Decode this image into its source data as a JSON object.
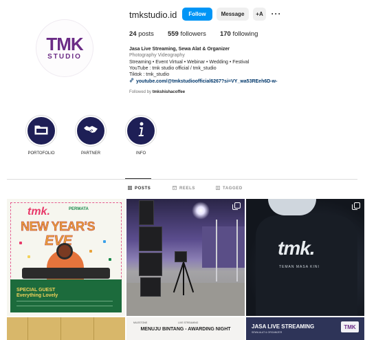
{
  "profile": {
    "username": "tmkstudio.id",
    "avatar_text": "TMK",
    "avatar_subtext": "STUDIO",
    "follow_label": "Follow",
    "message_label": "Message",
    "suggest_icon": "+A",
    "more_icon": "···"
  },
  "stats": {
    "posts_count": "24",
    "posts_label": "posts",
    "followers_count": "559",
    "followers_label": "followers",
    "following_count": "170",
    "following_label": "following"
  },
  "bio": {
    "name": "Jasa Live Streaming, Sewa Alat & Organizer",
    "category": "Photography Videography",
    "line1": "Streaming • Event Virtual • Webinar • Wedding • Festival",
    "line2": "YouTube : tmk studio official / tmk_studio",
    "line3": "Tiktok : tmk_studio",
    "link": "youtube.com/@tmkstudioofficial6267?si=VY_wa53REeh6D-w-",
    "followed_prefix": "Followed by",
    "followed_by": "tmkshishacoffee"
  },
  "highlights": [
    {
      "label": "PORTOFOLIO",
      "icon": "folder-icon"
    },
    {
      "label": "PARTNER",
      "icon": "handshake-icon"
    },
    {
      "label": "INFO",
      "icon": "info-icon"
    }
  ],
  "tabs": [
    {
      "label": "POSTS",
      "icon": "grid-icon",
      "active": true
    },
    {
      "label": "REELS",
      "icon": "reels-icon",
      "active": false
    },
    {
      "label": "TAGGED",
      "icon": "tagged-icon",
      "active": false
    }
  ],
  "posts": {
    "p1": {
      "brand": "tmk.",
      "venue": "PERMATA",
      "title1": "NEW YEAR'S",
      "title2": "EVE",
      "special": "SPECIAL GUEST",
      "guest": "Everything Lovely"
    },
    "p3": {
      "logo": "tmk.",
      "sub": "TEMAN MASA KINI"
    },
    "p5": {
      "head1": "MILESTONE",
      "head2": "LIVE STREAMING",
      "title": "MENUJU BINTANG - AWARDING NIGHT"
    },
    "p6": {
      "title": "JASA LIVE STREAMING",
      "sub": "SEWA ALAT & ORGANIZER",
      "logo": "TMK"
    }
  },
  "colors": {
    "follow_button": "#0095f6",
    "highlight_circle": "#1e1f56",
    "link": "#00376b",
    "brand_purple": "#6b2c86",
    "brand_pink": "#d6307a"
  }
}
